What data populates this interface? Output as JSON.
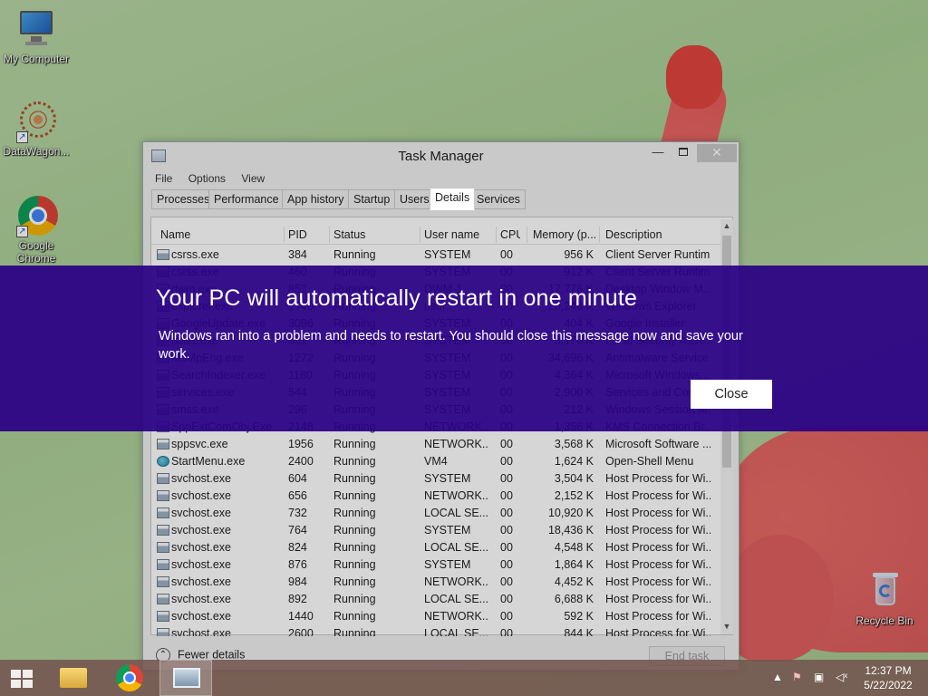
{
  "desktop": {
    "icons": [
      {
        "label": "My Computer"
      },
      {
        "label": "DataWagon..."
      },
      {
        "label": "Google Chrome"
      },
      {
        "label": "Recycle Bin"
      }
    ]
  },
  "task_manager": {
    "title": "Task Manager",
    "window_buttons": {
      "minimize": "—",
      "close": "✕"
    },
    "menu": [
      "File",
      "Options",
      "View"
    ],
    "tabs": [
      "Processes",
      "Performance",
      "App history",
      "Startup",
      "Users",
      "Details",
      "Services"
    ],
    "active_tab": "Details",
    "columns": {
      "name": "Name",
      "pid": "PID",
      "status": "Status",
      "user": "User name",
      "cpu": "CPU",
      "memory": "Memory (p...",
      "description": "Description"
    },
    "rows": [
      {
        "name": "csrss.exe",
        "pid": "384",
        "status": "Running",
        "user": "SYSTEM",
        "cpu": "00",
        "mem": "956 K",
        "desc": "Client Server Runtim...",
        "icon": "app"
      },
      {
        "name": "csrss.exe",
        "pid": "460",
        "status": "Running",
        "user": "SYSTEM",
        "cpu": "00",
        "mem": "912 K",
        "desc": "Client Server Runtim...",
        "icon": "app"
      },
      {
        "name": "dwm.exe",
        "pid": "852",
        "status": "Running",
        "user": "DWM-1",
        "cpu": "00",
        "mem": "17,776 K",
        "desc": "Desktop Window M...",
        "icon": "app"
      },
      {
        "name": "explorer.exe",
        "pid": "1740",
        "status": "Running",
        "user": "user",
        "cpu": "00",
        "mem": "20,248 K",
        "desc": "Windows Explorer",
        "icon": "app"
      },
      {
        "name": "GoogleUpdate.exe",
        "pid": "3096",
        "status": "Running",
        "user": "SYSTEM",
        "cpu": "00",
        "mem": "404 K",
        "desc": "Google Installer",
        "icon": "app"
      },
      {
        "name": "lsass.exe",
        "pid": "532",
        "status": "Running",
        "user": "SYSTEM",
        "cpu": "00",
        "mem": "3,176 K",
        "desc": "Local Security Auth...",
        "icon": "app"
      },
      {
        "name": "MsMpEng.exe",
        "pid": "1272",
        "status": "Running",
        "user": "SYSTEM",
        "cpu": "00",
        "mem": "34,696 K",
        "desc": "Antimalware Service...",
        "icon": "app"
      },
      {
        "name": "SearchIndexer.exe",
        "pid": "1180",
        "status": "Running",
        "user": "SYSTEM",
        "cpu": "00",
        "mem": "4,364 K",
        "desc": "Microsoft Windows...",
        "icon": "app"
      },
      {
        "name": "services.exe",
        "pid": "544",
        "status": "Running",
        "user": "SYSTEM",
        "cpu": "00",
        "mem": "2,900 K",
        "desc": "Services and Contr...",
        "icon": "app"
      },
      {
        "name": "smss.exe",
        "pid": "296",
        "status": "Running",
        "user": "SYSTEM",
        "cpu": "00",
        "mem": "212 K",
        "desc": "Windows Session M...",
        "icon": "app"
      },
      {
        "name": "SppExtComObj.Exe",
        "pid": "2148",
        "status": "Running",
        "user": "NETWORK...",
        "cpu": "00",
        "mem": "1,356 K",
        "desc": "KMS Connection Br...",
        "icon": "app"
      },
      {
        "name": "sppsvc.exe",
        "pid": "1956",
        "status": "Running",
        "user": "NETWORK...",
        "cpu": "00",
        "mem": "3,568 K",
        "desc": "Microsoft Software ...",
        "icon": "app"
      },
      {
        "name": "StartMenu.exe",
        "pid": "2400",
        "status": "Running",
        "user": "VM4",
        "cpu": "00",
        "mem": "1,624 K",
        "desc": "Open-Shell Menu",
        "icon": "globe"
      },
      {
        "name": "svchost.exe",
        "pid": "604",
        "status": "Running",
        "user": "SYSTEM",
        "cpu": "00",
        "mem": "3,504 K",
        "desc": "Host Process for Wi...",
        "icon": "app"
      },
      {
        "name": "svchost.exe",
        "pid": "656",
        "status": "Running",
        "user": "NETWORK...",
        "cpu": "00",
        "mem": "2,152 K",
        "desc": "Host Process for Wi...",
        "icon": "app"
      },
      {
        "name": "svchost.exe",
        "pid": "732",
        "status": "Running",
        "user": "LOCAL SE...",
        "cpu": "00",
        "mem": "10,920 K",
        "desc": "Host Process for Wi...",
        "icon": "app"
      },
      {
        "name": "svchost.exe",
        "pid": "764",
        "status": "Running",
        "user": "SYSTEM",
        "cpu": "00",
        "mem": "18,436 K",
        "desc": "Host Process for Wi...",
        "icon": "app"
      },
      {
        "name": "svchost.exe",
        "pid": "824",
        "status": "Running",
        "user": "LOCAL SE...",
        "cpu": "00",
        "mem": "4,548 K",
        "desc": "Host Process for Wi...",
        "icon": "app"
      },
      {
        "name": "svchost.exe",
        "pid": "876",
        "status": "Running",
        "user": "SYSTEM",
        "cpu": "00",
        "mem": "1,864 K",
        "desc": "Host Process for Wi...",
        "icon": "app"
      },
      {
        "name": "svchost.exe",
        "pid": "984",
        "status": "Running",
        "user": "NETWORK...",
        "cpu": "00",
        "mem": "4,452 K",
        "desc": "Host Process for Wi...",
        "icon": "app"
      },
      {
        "name": "svchost.exe",
        "pid": "892",
        "status": "Running",
        "user": "LOCAL SE...",
        "cpu": "00",
        "mem": "6,688 K",
        "desc": "Host Process for Wi...",
        "icon": "app"
      },
      {
        "name": "svchost.exe",
        "pid": "1440",
        "status": "Running",
        "user": "NETWORK...",
        "cpu": "00",
        "mem": "592 K",
        "desc": "Host Process for Wi...",
        "icon": "app"
      },
      {
        "name": "svchost.exe",
        "pid": "2600",
        "status": "Running",
        "user": "LOCAL SE...",
        "cpu": "00",
        "mem": "844 K",
        "desc": "Host Process for Wi...",
        "icon": "app"
      }
    ],
    "footer": {
      "fewer_details": "Fewer details",
      "end_task": "End task"
    }
  },
  "banner": {
    "title": "Your PC will automatically restart in one minute",
    "message": "Windows ran into a problem and needs to restart. You should close this message now and save your work.",
    "close_label": "Close",
    "background": "#2a0084"
  },
  "taskbar": {
    "clock": {
      "time": "12:37 PM",
      "date": "5/22/2022"
    }
  }
}
